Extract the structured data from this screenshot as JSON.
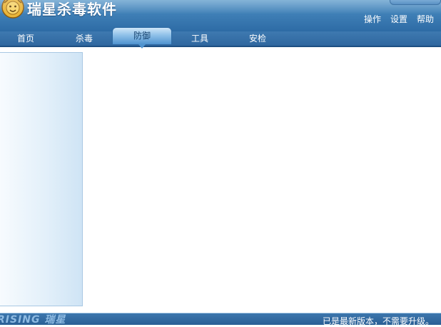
{
  "header": {
    "title": "瑞星杀毒软件",
    "logo_icon": "lion-shield-icon",
    "menu": [
      "操作",
      "设置",
      "帮助"
    ]
  },
  "tabs": [
    {
      "label": "首页"
    },
    {
      "label": "杀毒"
    },
    {
      "label": "防御",
      "active": true
    },
    {
      "label": "工具"
    },
    {
      "label": "安检"
    }
  ],
  "footer": {
    "brand": "RISING 瑞星",
    "status": "已是最新版本，不需要升级。"
  },
  "colors": {
    "header_blue": "#3f7fb6",
    "tab_active": "#8fc0e8",
    "sidebar": "#e3f0fa",
    "logo_gold": "#e8b53a"
  }
}
